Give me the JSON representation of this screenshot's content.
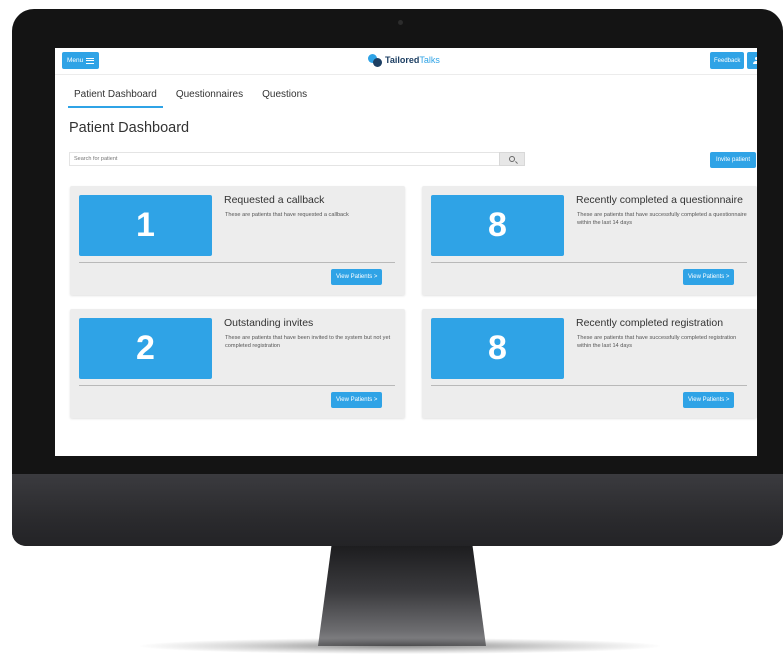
{
  "app": {
    "logo_bold": "Tailored",
    "logo_light": "Talks"
  },
  "header": {
    "menu_label": "Menu",
    "feedback_label": "Feedback"
  },
  "tabs": [
    {
      "label": "Patient Dashboard",
      "active": true
    },
    {
      "label": "Questionnaires",
      "active": false
    },
    {
      "label": "Questions",
      "active": false
    }
  ],
  "page": {
    "title": "Patient Dashboard"
  },
  "search": {
    "placeholder": "Search for patient",
    "value": ""
  },
  "invite_label": "Invite patient",
  "cards": [
    {
      "count": "1",
      "title": "Requested a callback",
      "description": "These are patients that have requested a callback",
      "button": "View Patients >"
    },
    {
      "count": "8",
      "title": "Recently completed a questionnaire",
      "description": "These are patients that have successfully completed a questionnaire within the last 14 days",
      "button": "View Patients >"
    },
    {
      "count": "2",
      "title": "Outstanding invites",
      "description": "These are patients that have been invited to the system but not yet completed registration",
      "button": "View Patients >"
    },
    {
      "count": "8",
      "title": "Recently completed registration",
      "description": "These are patients that have successfully completed registration within the last 14 days",
      "button": "View Patients >"
    }
  ],
  "colors": {
    "accent": "#2fa3e6",
    "brand_dark": "#1d3f63",
    "card_bg": "#ededed"
  }
}
